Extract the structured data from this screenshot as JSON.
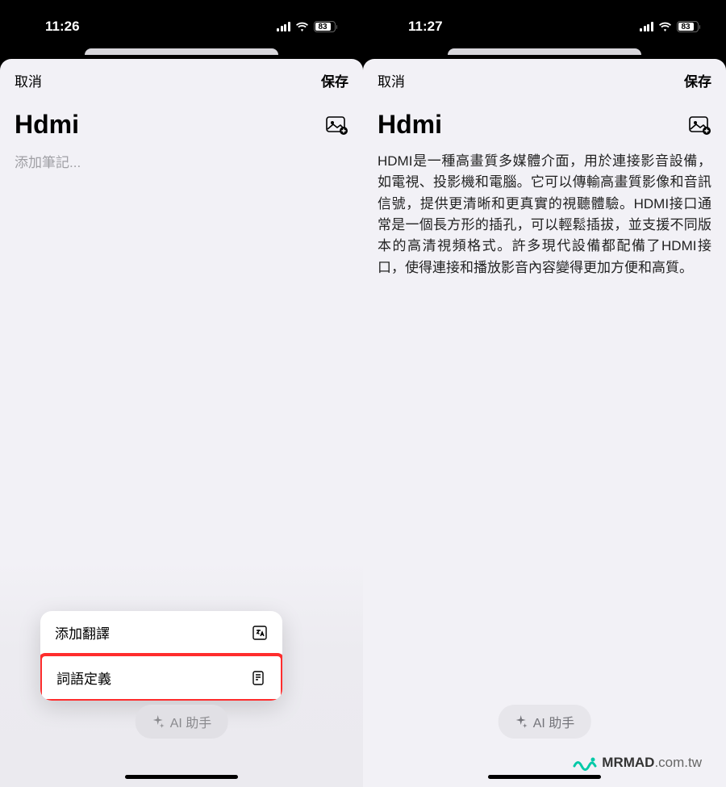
{
  "left": {
    "status": {
      "time": "11:26",
      "battery": "83"
    },
    "header": {
      "cancel": "取消",
      "save": "保存"
    },
    "title": "Hdmi",
    "notePlaceholder": "添加筆記...",
    "menu": {
      "translate": "添加翻譯",
      "define": "詞語定義"
    },
    "aiButton": "AI 助手"
  },
  "right": {
    "status": {
      "time": "11:27",
      "battery": "83"
    },
    "header": {
      "cancel": "取消",
      "save": "保存"
    },
    "title": "Hdmi",
    "bodyText": "HDMI是一種高畫質多媒體介面，用於連接影音設備，如電視、投影機和電腦。它可以傳輸高畫質影像和音訊信號，提供更清晰和更真實的視聽體驗。HDMI接口通常是一個長方形的插孔，可以輕鬆插拔，並支援不同版本的高清視頻格式。許多現代設備都配備了HDMI接口，使得連接和播放影音內容變得更加方便和高質。",
    "aiButton": "AI 助手"
  },
  "watermark": {
    "brand": "MRMAD",
    "domain": ".com.tw"
  }
}
